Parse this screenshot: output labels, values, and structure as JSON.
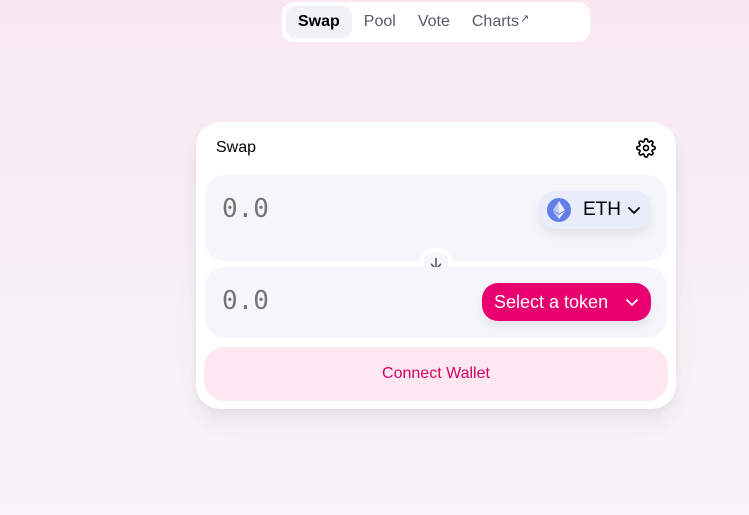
{
  "nav": {
    "tabs": [
      {
        "label": "Swap",
        "active": true
      },
      {
        "label": "Pool",
        "active": false
      },
      {
        "label": "Vote",
        "active": false
      },
      {
        "label": "Charts",
        "external": true
      }
    ],
    "external_glyph": "↗"
  },
  "swap_card": {
    "title": "Swap",
    "settings_icon": "gear-icon",
    "input": {
      "placeholder": "0.0",
      "token": "ETH",
      "token_icon": "ethereum-icon"
    },
    "switch_icon": "arrow-down-icon",
    "output": {
      "placeholder": "0.0",
      "select_label": "Select a token"
    },
    "connect_label": "Connect Wallet"
  },
  "colors": {
    "accent": "#e8006f",
    "connect_bg": "#fde8f1",
    "connect_text": "#d50066",
    "eth_blue": "#627eea"
  }
}
